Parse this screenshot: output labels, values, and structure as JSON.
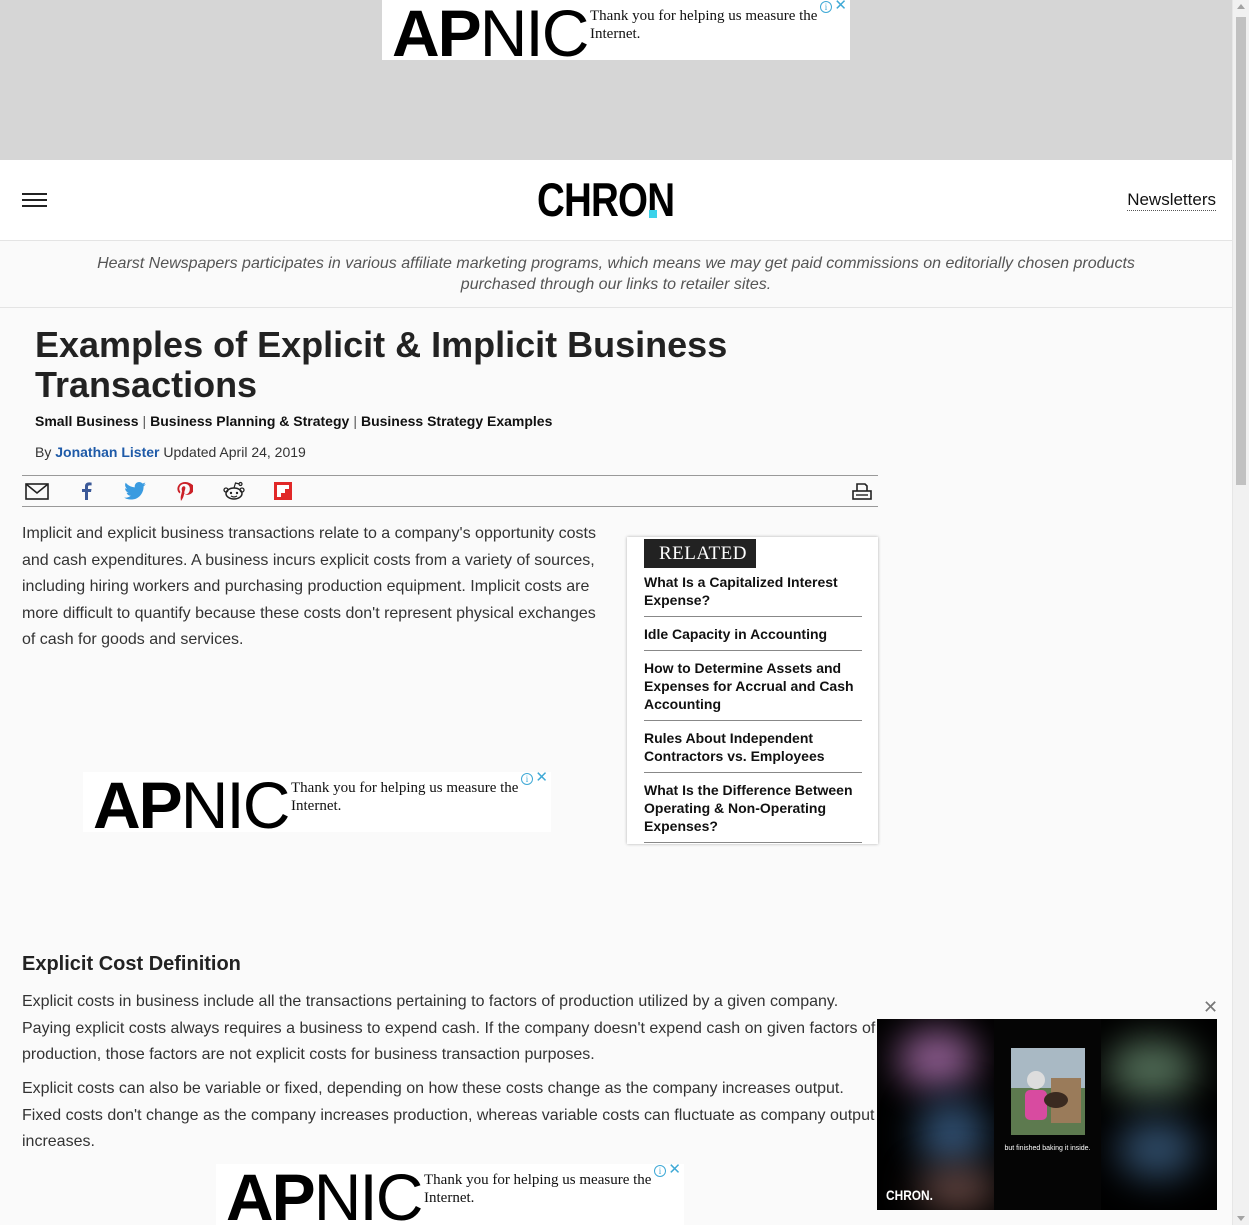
{
  "ads": {
    "logo_bold": "AP",
    "logo_light": "NIC",
    "message": "Thank you for helping us measure the Internet.",
    "info_glyph": "i",
    "close_glyph": "✕"
  },
  "header": {
    "logo": "CHRON",
    "newsletters": "Newsletters",
    "brand_accent": "#3bd2ea"
  },
  "disclaimer": "Hearst Newspapers participates in various affiliate marketing programs, which means we may get paid commissions on editorially chosen products purchased through our links to retailer sites.",
  "article": {
    "title": "Examples of Explicit & Implicit Business Transactions",
    "breadcrumbs": [
      "Small Business",
      "Business Planning & Strategy",
      "Business Strategy Examples"
    ],
    "byline_prefix": "By",
    "author": "Jonathan Lister",
    "updated": "Updated April 24, 2019",
    "share_icons": [
      "email-icon",
      "facebook-icon",
      "twitter-icon",
      "pinterest-icon",
      "reddit-icon",
      "flipboard-icon",
      "print-icon"
    ],
    "intro": "Implicit and explicit business transactions relate to a company's opportunity costs and cash expenditures. A business incurs explicit costs from a variety of sources, including hiring workers and purchasing production equipment. Implicit costs are more difficult to quantify because these costs don't represent physical exchanges of cash for goods and services.",
    "section_heading": "Explicit Cost Definition",
    "p1": "Explicit costs in business include all the transactions pertaining to factors of production utilized by a given company. Paying explicit costs always requires a business to expend cash. If the company doesn't expend cash on given factors of production, those factors are not explicit costs for business transaction purposes.",
    "p2": "Explicit costs can also be variable or fixed, depending on how these costs change as the company increases output. Fixed costs don't change as the company increases production, whereas variable costs can fluctuate as company output increases."
  },
  "related": {
    "label": "RELATED",
    "items": [
      "What Is a Capitalized Interest Expense?",
      "Idle Capacity in Accounting",
      "How to Determine Assets and Expenses for Accrual and Cash Accounting",
      "Rules About Independent Contractors vs. Employees",
      "What Is the Difference Between Operating & Non-Operating Expenses?"
    ]
  },
  "video": {
    "caption": "but finished baking it inside.",
    "logo": "CHRON.",
    "close_glyph": "✕"
  }
}
